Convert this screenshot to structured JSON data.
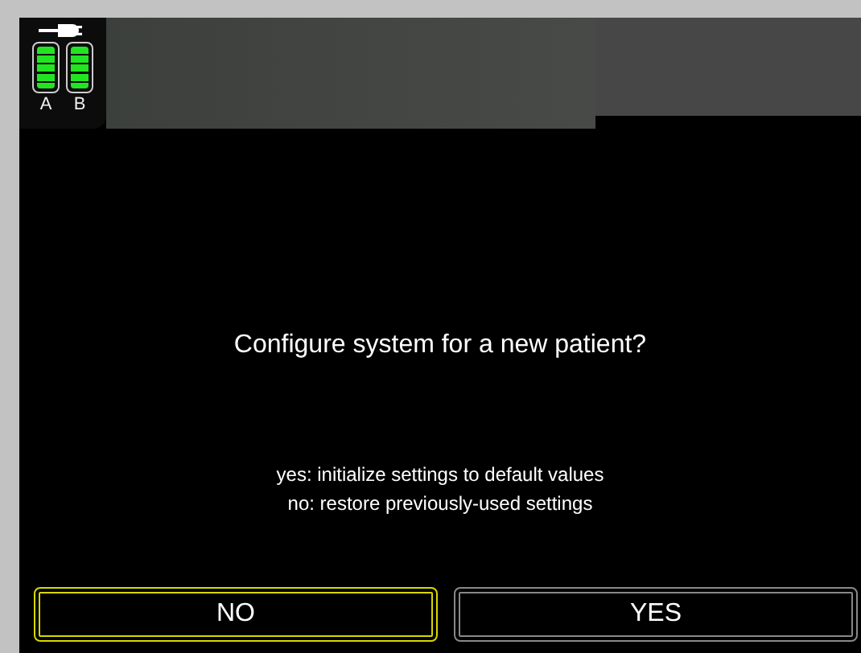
{
  "power_status": {
    "batteries": [
      {
        "label": "A",
        "level": 1.0
      },
      {
        "label": "B",
        "level": 1.0
      }
    ]
  },
  "dialog": {
    "question": "Configure system for a new patient?",
    "hints": [
      "yes: initialize settings to default values",
      "no: restore previously-used settings"
    ]
  },
  "buttons": [
    {
      "label": "NO",
      "selected": true
    },
    {
      "label": "YES",
      "selected": false
    }
  ]
}
